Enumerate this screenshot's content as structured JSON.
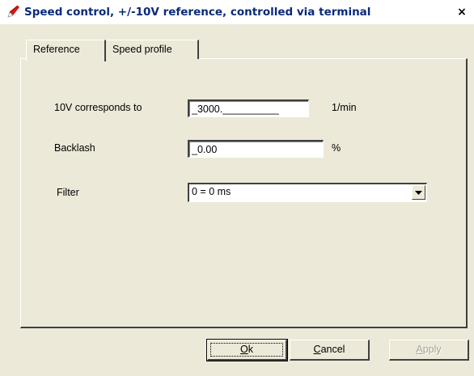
{
  "window": {
    "title": "Speed control, +/-10V reference, controlled via terminal",
    "close_glyph": "×"
  },
  "tabs": [
    {
      "label": "Reference",
      "active": true
    },
    {
      "label": "Speed profile",
      "active": false
    }
  ],
  "form": {
    "reference": {
      "label": "10V corresponds to",
      "value": "_3000.__________",
      "unit": "1/min"
    },
    "backlash": {
      "label": "Backlash",
      "value": "_0.00",
      "unit": "%"
    },
    "filter": {
      "label": "Filter",
      "selected": "0 = 0 ms"
    }
  },
  "buttons": {
    "ok": {
      "mnemonic": "O",
      "rest": "k"
    },
    "cancel": {
      "mnemonic": "C",
      "rest": "ancel"
    },
    "apply": {
      "mnemonic": "A",
      "rest": "pply",
      "enabled": false
    }
  },
  "icons": {
    "app": "speed-control-app-icon",
    "close": "close-icon",
    "dropdown": "chevron-down-icon"
  }
}
